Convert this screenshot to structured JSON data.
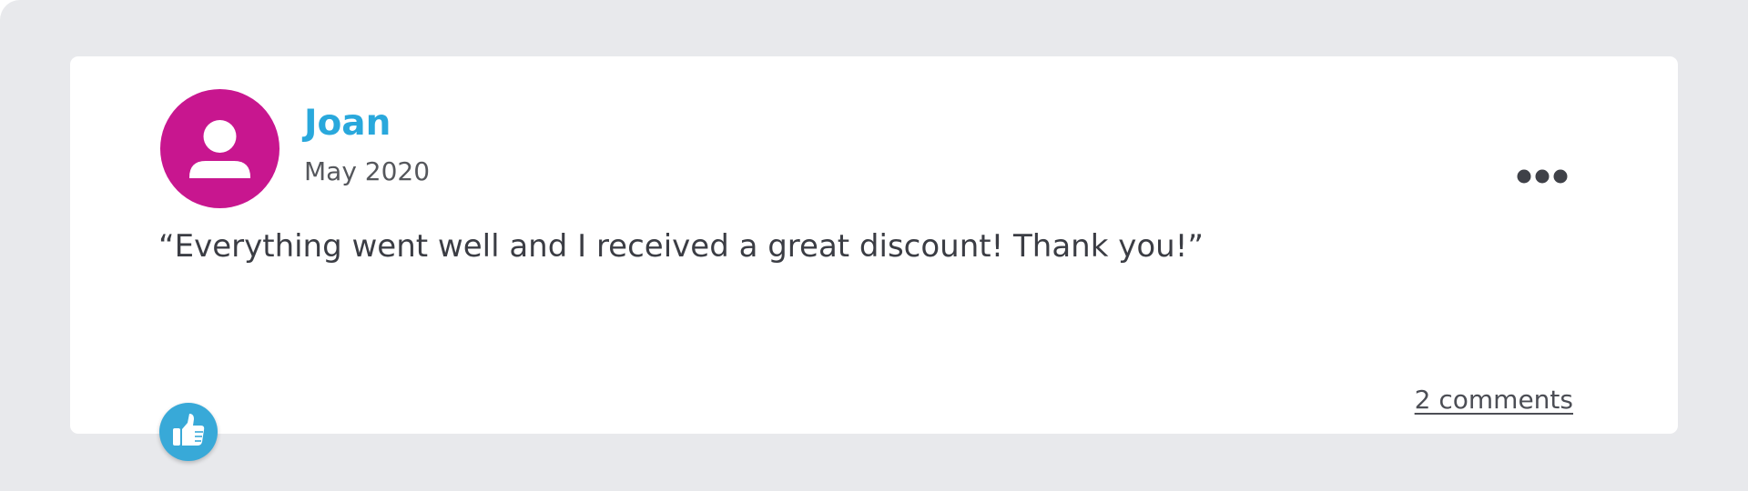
{
  "review": {
    "author": "Joan",
    "date": "May 2020",
    "text": "“Everything went well and I received a great discount! Thank you!”",
    "comments_link": "2 comments",
    "avatar_icon": "user-icon",
    "menu_icon": "more-options-icon",
    "like_icon": "thumbs-up-icon"
  },
  "colors": {
    "page_background": "#e8e9ec",
    "card_background": "#ffffff",
    "avatar": "#c8168f",
    "author_name": "#29a8dc",
    "like_button": "#38a9d8",
    "body_text": "#3b3d44"
  }
}
